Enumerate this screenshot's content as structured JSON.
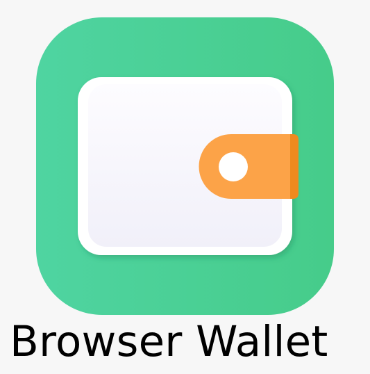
{
  "app": {
    "name": "Browser Wallet",
    "icon": "wallet-icon"
  },
  "colors": {
    "page_background": "#f7f7f7",
    "icon_tile_start": "#4fd4a1",
    "icon_tile_end": "#46cc8a",
    "wallet_body": "#ffffff",
    "wallet_inner_top": "#fcfbff",
    "wallet_inner_bottom": "#f2f1fa",
    "clasp": "#fca348",
    "clasp_shadow": "#ef8a1f",
    "clasp_button": "#ffffff",
    "label_text": "#000000"
  }
}
